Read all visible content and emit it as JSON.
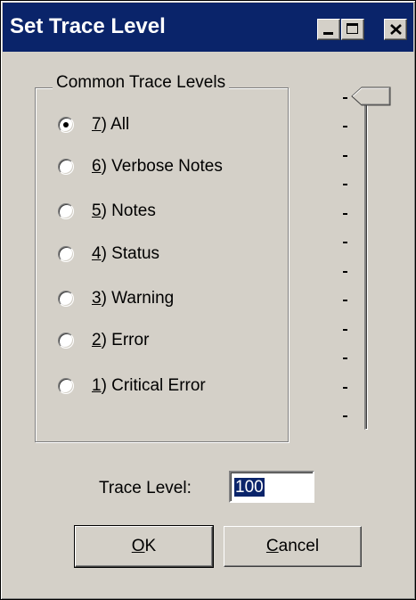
{
  "window": {
    "title": "Set Trace Level"
  },
  "group": {
    "label": "Common Trace Levels",
    "options": [
      {
        "key": "7",
        "text": ") All",
        "checked": true
      },
      {
        "key": "6",
        "text": ") Verbose Notes",
        "checked": false
      },
      {
        "key": "5",
        "text": ") Notes",
        "checked": false
      },
      {
        "key": "4",
        "text": ") Status",
        "checked": false
      },
      {
        "key": "3",
        "text": ") Warning",
        "checked": false
      },
      {
        "key": "2",
        "text": ") Error",
        "checked": false
      },
      {
        "key": "1",
        "text": ") Critical Error",
        "checked": false
      }
    ]
  },
  "slider": {
    "tick_count": 12,
    "value_fraction": 1.0
  },
  "trace_level": {
    "label": "Trace Level:",
    "value": "100"
  },
  "buttons": {
    "ok": {
      "mnemonic": "O",
      "rest": "K"
    },
    "cancel": {
      "mnemonic": "C",
      "rest": "ancel"
    }
  },
  "colors": {
    "titlebar": "#0a246a",
    "face": "#d4d0c8",
    "selection": "#0a246a"
  },
  "icons": [
    "minimize-icon",
    "maximize-icon",
    "close-icon",
    "radio-checked-icon",
    "radio-unchecked-icon",
    "slider-thumb-icon"
  ]
}
